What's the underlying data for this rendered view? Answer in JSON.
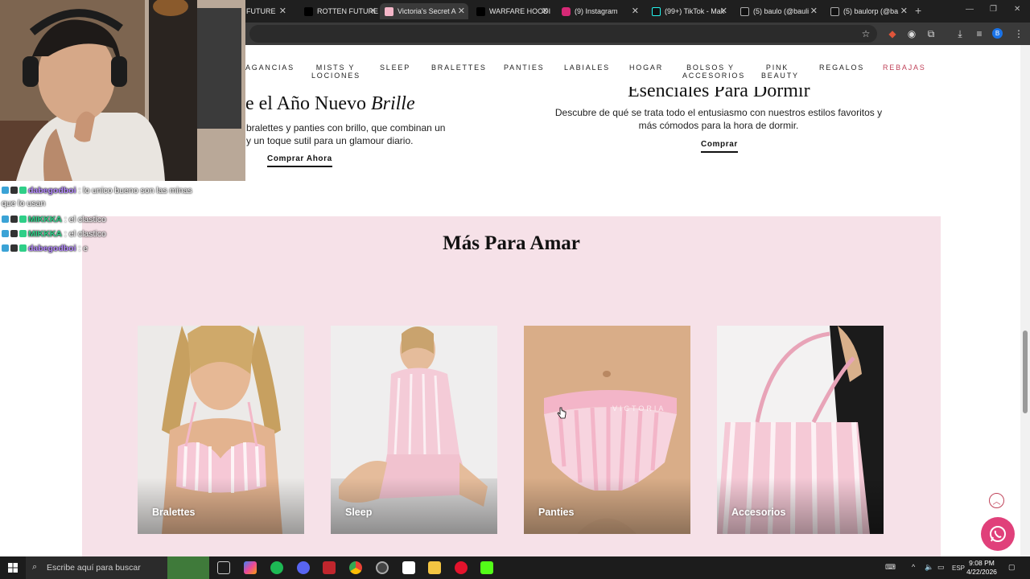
{
  "browser": {
    "tabs": [
      {
        "label": "FUTURE",
        "favicon_color": "#000000"
      },
      {
        "label": "ROTTEN FUTURE",
        "favicon_color": "#000000"
      },
      {
        "label": "Victoria's Secret A",
        "favicon_color": "#f4b6c8",
        "active": true
      },
      {
        "label": "WARFARE HOODI",
        "favicon_color": "#000000"
      },
      {
        "label": "(9) Instagram",
        "favicon_color": "#d62976"
      },
      {
        "label": "(99+) TikTok - Mak",
        "favicon_color": "#111111"
      },
      {
        "label": "(5) baulo (@bauli",
        "favicon_color": "#111111"
      },
      {
        "label": "(5) baulorp (@ba",
        "favicon_color": "#111111"
      }
    ]
  },
  "nav": {
    "items": [
      "AGANCIAS",
      "MISTS Y LOCIONES",
      "SLEEP",
      "BRALETTES",
      "PANTIES",
      "LABIALES",
      "HOGAR",
      "BOLSOS Y ACCESORIOS",
      "PINK BEAUTY",
      "REGALOS",
      "REBAJAS"
    ]
  },
  "hero_left": {
    "title_prefix": "e el Año Nuevo ",
    "title_italic": "Brille",
    "text_line1": "bralettes y panties con brillo, que combinan un",
    "text_line2": "y un toque sutil para un glamour diario.",
    "link": "Comprar Ahora"
  },
  "hero_right": {
    "title": "Esenciales Para Dormir",
    "text_line1": "Descubre de qué se trata todo el entusiasmo con nuestros estilos favoritos y",
    "text_line2": "más cómodos para la hora de dormir.",
    "link": "Comprar"
  },
  "mas_para_amar": {
    "title": "Más Para Amar",
    "cards": [
      "Bralettes",
      "Sleep",
      "Panties",
      "Accesorios"
    ]
  },
  "chat": [
    {
      "user": "dabegodboi",
      "user_color": "#b487ff",
      "msg": " : lo unico bueno son las minas",
      "msg2": "que lo usan"
    },
    {
      "user": "MIKKKA",
      "user_color": "#2fcf88",
      "msg": " : el clastico"
    },
    {
      "user": "MIKKKA",
      "user_color": "#2fcf88",
      "msg": " : el clastico"
    },
    {
      "user": "dabegodboi",
      "user_color": "#b487ff",
      "msg": " : e"
    }
  ],
  "taskbar": {
    "search_placeholder": "Escribe aquí para buscar",
    "lang": "ESP",
    "time": "9:08 PM",
    "date": "4/22/2026"
  },
  "colors": {
    "brand_pink_bg": "#f6e1e8",
    "sale_red": "#c0435a",
    "whatsapp_pink": "#e0407a"
  }
}
